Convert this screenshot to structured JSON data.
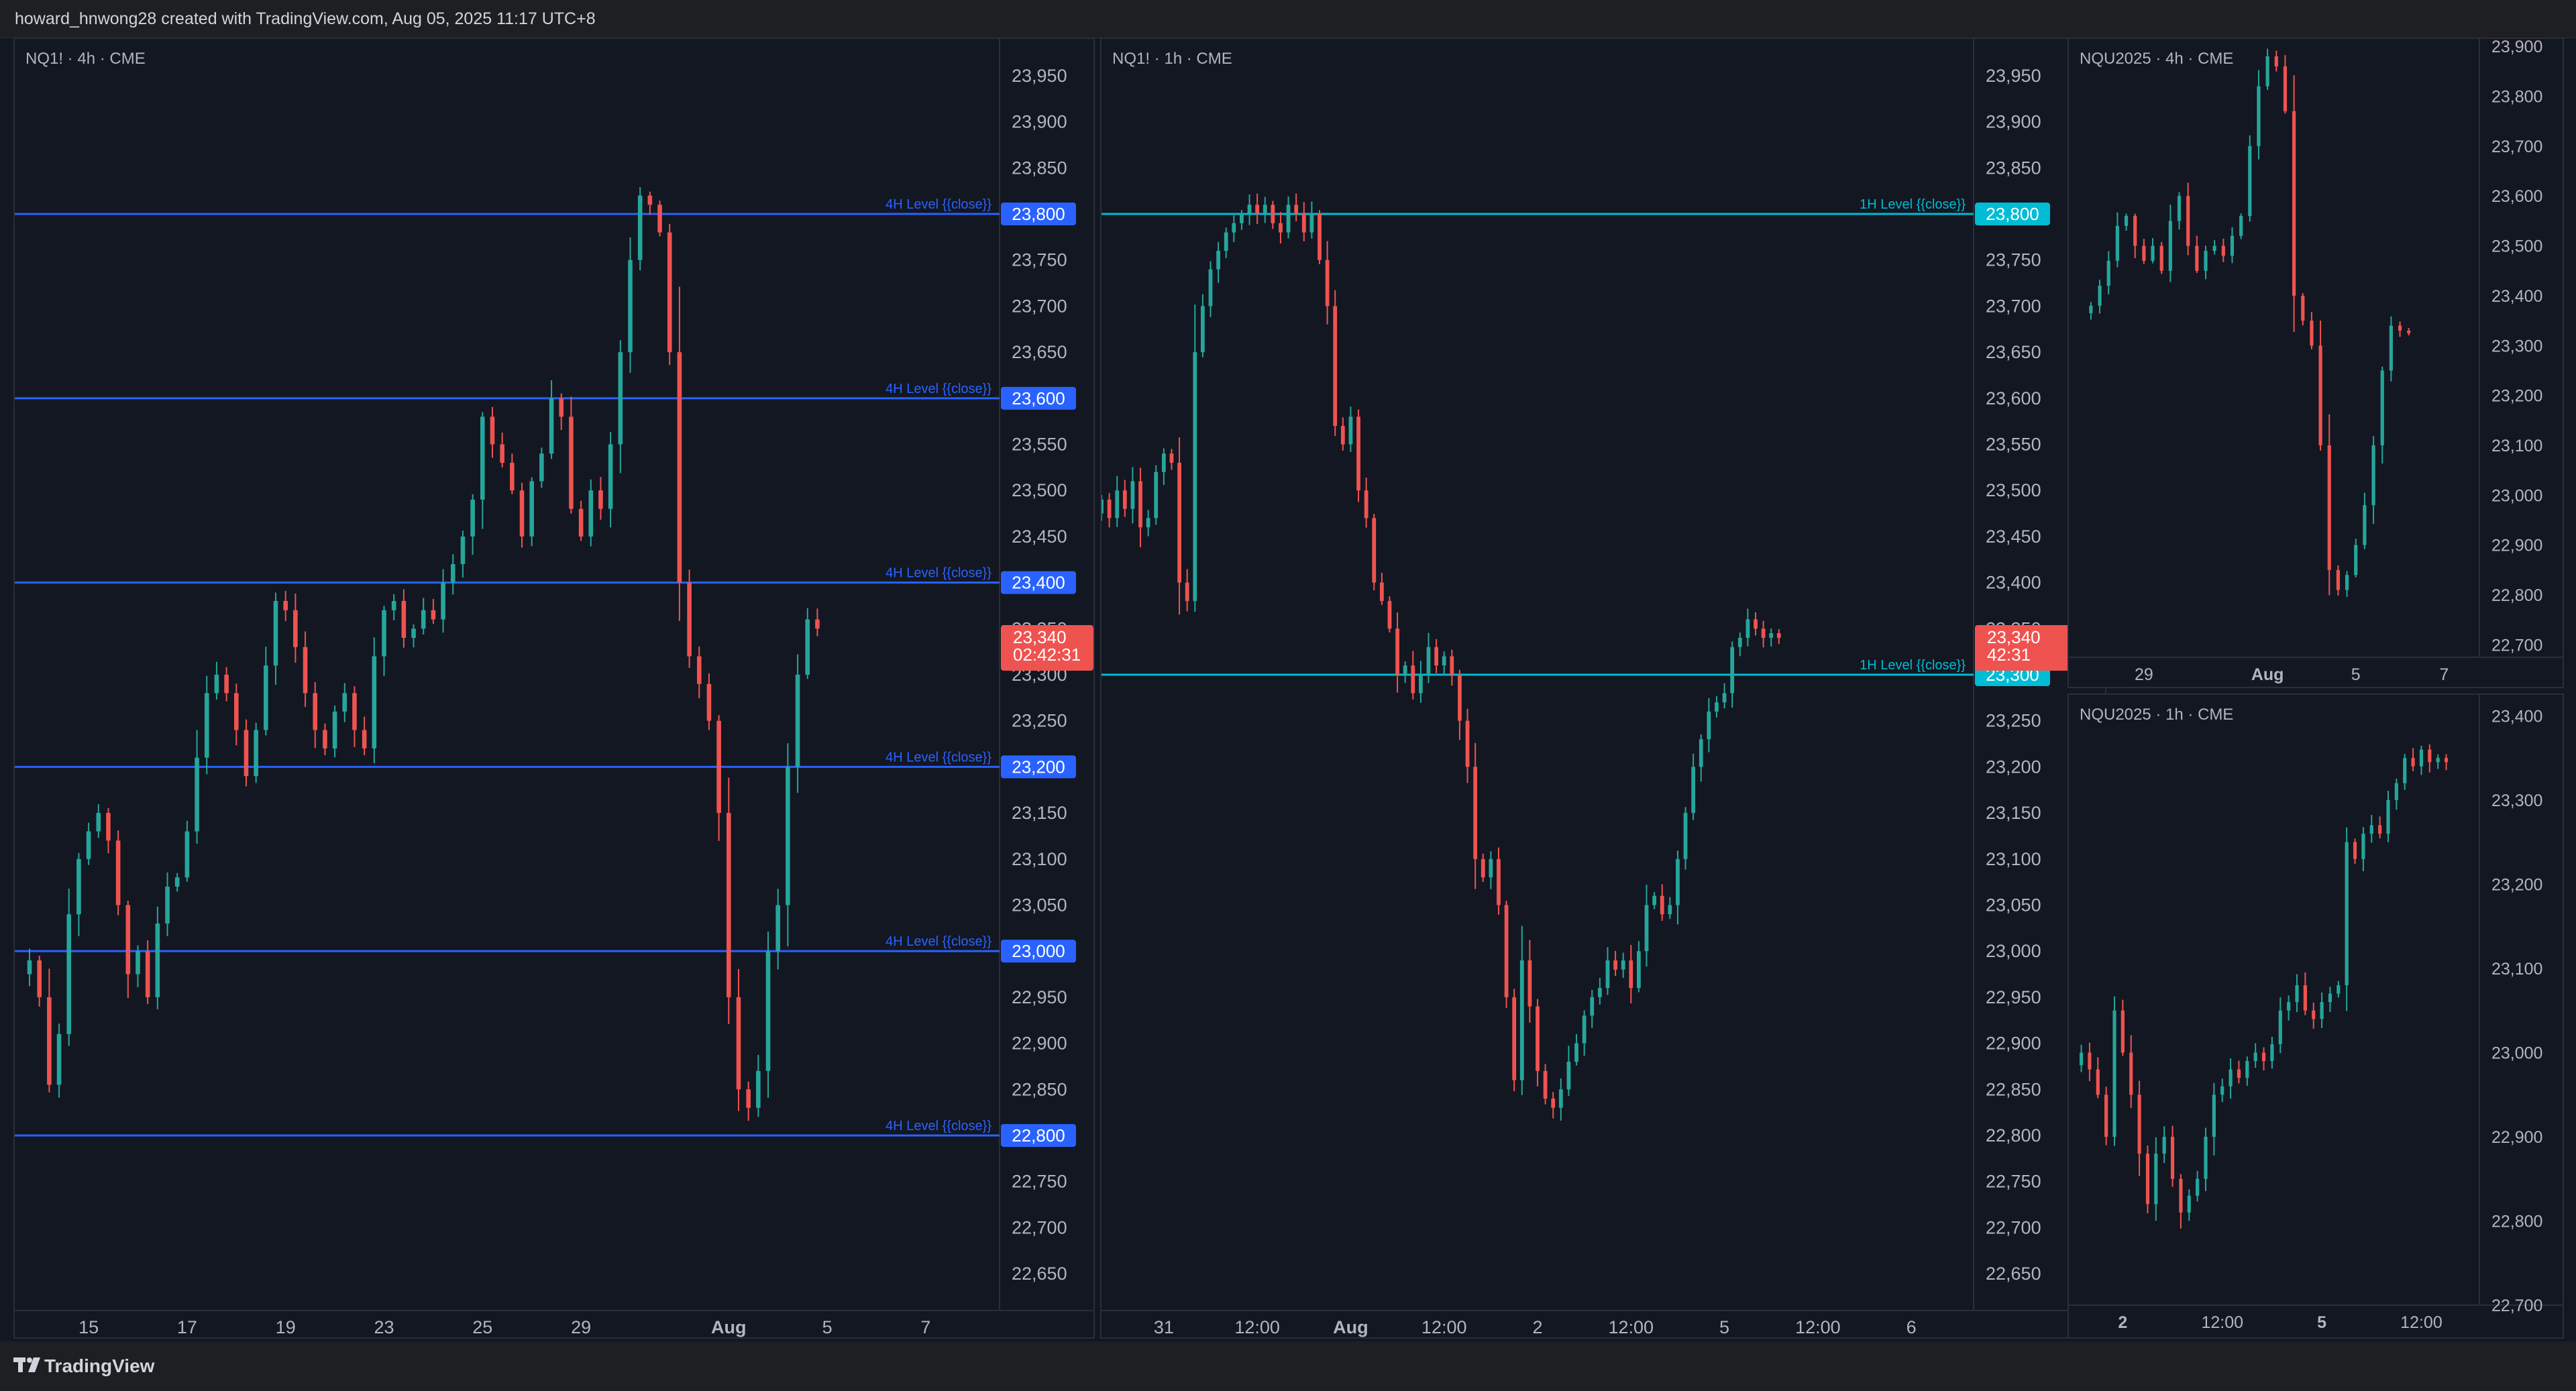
{
  "header": {
    "attribution": "howard_hnwong28 created with TradingView.com, Aug 05, 2025 11:17 UTC+8"
  },
  "footer": {
    "brand": "TradingView"
  },
  "colors": {
    "background": "#131722",
    "up": "#26a69a",
    "down": "#ef5350",
    "level_4h": "#2962ff",
    "level_1h": "#00bcd4",
    "text": "#b2b5be"
  },
  "chart_data": [
    {
      "id": "nq1-4h",
      "type": "candlestick",
      "title": "NQ1! · 4h · CME",
      "ylim": [
        22610,
        23990
      ],
      "y_ticks": [
        23950,
        23900,
        23850,
        23800,
        23750,
        23700,
        23650,
        23600,
        23550,
        23500,
        23450,
        23400,
        23350,
        23300,
        23250,
        23200,
        23150,
        23100,
        23050,
        23000,
        22950,
        22900,
        22850,
        22800,
        22750,
        22700,
        22650
      ],
      "x_ticks": [
        {
          "label": "15",
          "at": 6
        },
        {
          "label": "17",
          "at": 16
        },
        {
          "label": "19",
          "at": 26
        },
        {
          "label": "23",
          "at": 36
        },
        {
          "label": "25",
          "at": 46
        },
        {
          "label": "29",
          "at": 56
        },
        {
          "label": "Aug",
          "at": 71,
          "bold": true
        },
        {
          "label": "5",
          "at": 81
        },
        {
          "label": "7",
          "at": 91
        }
      ],
      "x_range": [
        -1.5,
        98.5
      ],
      "levels": [
        {
          "value": 23800,
          "label": "4H Level {{close}}",
          "color": "#2962ff"
        },
        {
          "value": 23600,
          "label": "4H Level {{close}}",
          "color": "#2962ff"
        },
        {
          "value": 23400,
          "label": "4H Level {{close}}",
          "color": "#2962ff"
        },
        {
          "value": 23200,
          "label": "4H Level {{close}}",
          "color": "#2962ff"
        },
        {
          "value": 23000,
          "label": "4H Level {{close}}",
          "color": "#2962ff"
        },
        {
          "value": 22800,
          "label": "4H Level {{close}}",
          "color": "#2962ff"
        }
      ],
      "last_price": {
        "value": 23340,
        "price_label": "23,340",
        "countdown": "02:42:31"
      },
      "closes": [
        22990,
        22950,
        22855,
        22910,
        23040,
        23100,
        23130,
        23150,
        23120,
        23050,
        22975,
        23000,
        22950,
        23030,
        23070,
        23080,
        23130,
        23210,
        23280,
        23300,
        23280,
        23240,
        23190,
        23240,
        23310,
        23380,
        23370,
        23330,
        23280,
        23240,
        23220,
        23260,
        23280,
        23240,
        23220,
        23320,
        23370,
        23380,
        23340,
        23350,
        23370,
        23360,
        23400,
        23420,
        23450,
        23490,
        23580,
        23550,
        23530,
        23500,
        23450,
        23510,
        23540,
        23600,
        23580,
        23480,
        23450,
        23500,
        23480,
        23550,
        23650,
        23750,
        23820,
        23810,
        23780,
        23650,
        23400,
        23320,
        23290,
        23250,
        23150,
        22950,
        22850,
        22830,
        22870,
        23000,
        23050,
        23200,
        23300,
        23360,
        23350
      ],
      "pattern": "real NQ 4h closes, sustained run from Jul 14 to a 23,820 peak on Jul 31, sharp drop to 22,830 on Aug 1, rebound to 23,340"
    },
    {
      "id": "nq1-1h",
      "type": "candlestick",
      "title": "NQ1! · 1h · CME",
      "ylim": [
        22610,
        23990
      ],
      "y_ticks": [
        23950,
        23900,
        23850,
        23800,
        23750,
        23700,
        23650,
        23600,
        23550,
        23500,
        23450,
        23400,
        23350,
        23300,
        23250,
        23200,
        23150,
        23100,
        23050,
        23000,
        22950,
        22900,
        22850,
        22800,
        22750,
        22700,
        22650
      ],
      "x_ticks": [
        {
          "label": "31",
          "at": 8
        },
        {
          "label": "12:00",
          "at": 20
        },
        {
          "label": "Aug",
          "at": 32,
          "bold": true
        },
        {
          "label": "12:00",
          "at": 44
        },
        {
          "label": "2",
          "at": 56
        },
        {
          "label": "12:00",
          "at": 68
        },
        {
          "label": "5",
          "at": 80
        },
        {
          "label": "12:00",
          "at": 92
        },
        {
          "label": "6",
          "at": 104
        }
      ],
      "x_range": [
        0,
        112
      ],
      "levels": [
        {
          "value": 23800,
          "label": "1H Level {{close}}",
          "color": "#00bcd4"
        },
        {
          "value": 23300,
          "label": "1H Level {{close}}",
          "color": "#00bcd4"
        }
      ],
      "last_price": {
        "value": 23340,
        "price_label": "23,340",
        "countdown": "42:31"
      },
      "closes": [
        23490,
        23470,
        23500,
        23480,
        23510,
        23460,
        23470,
        23520,
        23540,
        23530,
        23400,
        23380,
        23650,
        23700,
        23740,
        23760,
        23780,
        23790,
        23800,
        23810,
        23800,
        23810,
        23790,
        23780,
        23810,
        23800,
        23780,
        23800,
        23750,
        23700,
        23570,
        23550,
        23580,
        23500,
        23470,
        23400,
        23380,
        23350,
        23300,
        23310,
        23280,
        23300,
        23330,
        23310,
        23320,
        23300,
        23250,
        23200,
        23100,
        23080,
        23100,
        23050,
        22950,
        22860,
        22990,
        22940,
        22870,
        22840,
        22830,
        22850,
        22880,
        22900,
        22930,
        22950,
        22960,
        22990,
        22980,
        22990,
        22960,
        23000,
        23050,
        23060,
        23040,
        23050,
        23100,
        23150,
        23200,
        23230,
        23260,
        23270,
        23280,
        23330,
        23340,
        23360,
        23350,
        23340,
        23345,
        23340
      ],
      "pattern": "real NQ 1h closes, base near 23,500, rally to 23,800 top, breakdown through 23,300 to 22,830 low, recovery to 23,340"
    },
    {
      "id": "nqu2025-4h",
      "type": "candlestick",
      "title": "NQU2025 · 4h · CME",
      "ylim": [
        22675,
        23915
      ],
      "y_ticks": [
        23900,
        23800,
        23700,
        23600,
        23500,
        23400,
        23300,
        23200,
        23100,
        23000,
        22900,
        22800,
        22700
      ],
      "x_ticks": [
        {
          "label": "29",
          "at": 6
        },
        {
          "label": "Aug",
          "at": 20,
          "bold": true
        },
        {
          "label": "5",
          "at": 30
        },
        {
          "label": "7",
          "at": 40
        }
      ],
      "x_range": [
        -2.5,
        44
      ],
      "last_price": {
        "value": 23330
      },
      "closes": [
        23380,
        23420,
        23470,
        23540,
        23560,
        23500,
        23470,
        23500,
        23450,
        23550,
        23600,
        23500,
        23450,
        23490,
        23500,
        23480,
        23520,
        23560,
        23700,
        23820,
        23880,
        23860,
        23770,
        23400,
        23350,
        23300,
        23100,
        22850,
        22810,
        22840,
        22900,
        22980,
        23100,
        23250,
        23340,
        23330,
        23325
      ],
      "pattern": "real NQU 4h closes, rise to 23,880 peak, sharp drop to 22,810 on Aug 1, rebound to 23,330"
    },
    {
      "id": "nqu2025-1h",
      "type": "candlestick",
      "title": "NQU2025 · 1h · CME",
      "ylim": [
        22700,
        23425
      ],
      "y_ticks": [
        23400,
        23300,
        23200,
        23100,
        23000,
        22900,
        22800,
        22700
      ],
      "x_ticks": [
        {
          "label": "2",
          "at": 5,
          "bold": true
        },
        {
          "label": "12:00",
          "at": 17
        },
        {
          "label": "5",
          "at": 29,
          "bold": true
        },
        {
          "label": "12:00",
          "at": 41
        }
      ],
      "x_range": [
        -1.5,
        48
      ],
      "last_price": {
        "value": 23345
      },
      "closes": [
        23000,
        22980,
        22950,
        22900,
        23050,
        23000,
        22950,
        22880,
        22820,
        22880,
        22900,
        22850,
        22810,
        22830,
        22850,
        22900,
        22950,
        22960,
        22980,
        22970,
        22990,
        23000,
        22990,
        23010,
        23050,
        23060,
        23080,
        23050,
        23040,
        23060,
        23070,
        23080,
        23250,
        23230,
        23260,
        23270,
        23260,
        23300,
        23320,
        23350,
        23340,
        23360,
        23345,
        23350,
        23345
      ],
      "pattern": "real NQU 1h closes, 22,980 start, dip to 22,810, steady recovery, jump to 23,250, rise to 23,345"
    }
  ]
}
